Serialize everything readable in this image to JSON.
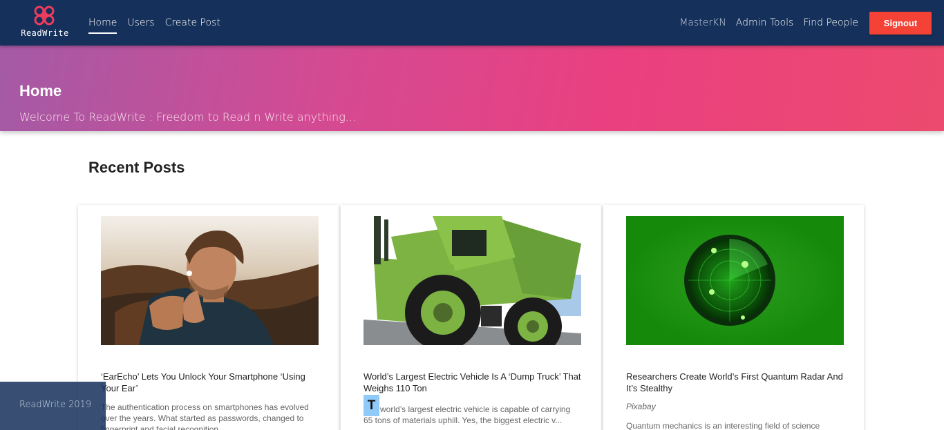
{
  "brand": {
    "name": "ReadWrite"
  },
  "nav": {
    "left": [
      "Home",
      "Users",
      "Create Post"
    ],
    "user": "MasterKN",
    "admin_tools": "Admin Tools",
    "find_people": "Find People",
    "signout": "Signout"
  },
  "hero": {
    "title": "Home",
    "subtitle": "Welcome To ReadWrite : Freedom to Read n Write anything..."
  },
  "recent": {
    "title": "Recent Posts",
    "posts": [
      {
        "image": "man-with-earbud",
        "title": "‘EarEcho’ Lets You Unlock Your Smartphone ‘Using Your Ear’",
        "text": "The authentication process on smartphones has evolved over the years. What started as passwords, changed to fingerprint and facial recognition..."
      },
      {
        "image": "green-dump-truck",
        "title": "World’s Largest Electric Vehicle Is A ‘Dump Truck’ That Weighs 110 Ton",
        "text": "The world’s largest electric vehicle is capable of carrying 65 tons of materials uphill. Yes, the biggest electric v..."
      },
      {
        "image": "green-radar",
        "title": "Researchers Create World’s First Quantum Radar And It’s Stealthy",
        "meta": "Pixabay",
        "text": "Quantum mechanics is an interesting field of science"
      }
    ]
  },
  "badge": "T",
  "footer": {
    "text": "ReadWrite 2019"
  },
  "colors": {
    "navbar": "#15305a",
    "signout": "#f44336",
    "hero_start": "#a45aa6",
    "hero_end": "#ec4a6e"
  }
}
